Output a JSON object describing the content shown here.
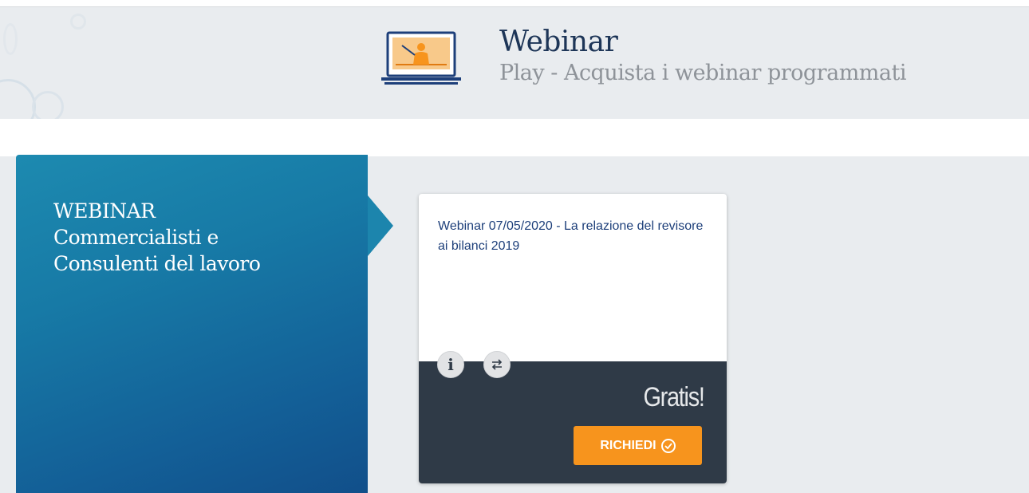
{
  "header": {
    "title": "Webinar",
    "subtitle": "Play - Acquista i webinar programmati",
    "icon": "presenter-screen-icon"
  },
  "category_panel": {
    "title_lines": [
      "WEBINAR",
      "Commercialisti e",
      "Consulenti del lavoro"
    ]
  },
  "card": {
    "title": "Webinar 07/05/2020 - La relazione del revisore ai bilanci 2019",
    "info_icon": "info-icon",
    "compare_icon": "swap-arrows-icon",
    "price": "Gratis!",
    "request_label": "RICHIEDI",
    "request_icon": "check-circle-icon"
  },
  "colors": {
    "panel_blue": "#177aa6",
    "card_dark": "#2f3a47",
    "accent_orange": "#f7941d",
    "title_navy": "#1d3557"
  }
}
